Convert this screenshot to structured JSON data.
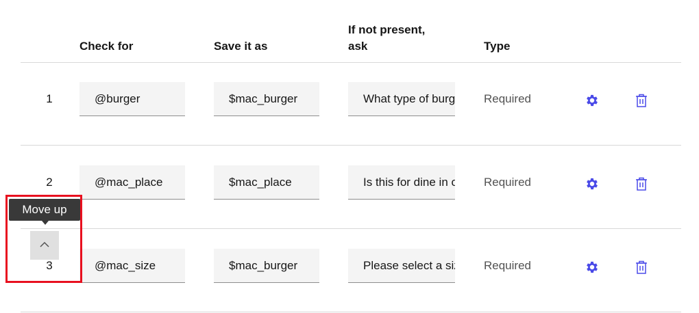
{
  "table": {
    "headers": {
      "check_for": "Check for",
      "save_it_as": "Save it as",
      "if_not_present_line1": "If not present,",
      "if_not_present_line2": "ask",
      "type": "Type"
    },
    "rows": [
      {
        "index": "1",
        "check_for": "@burger",
        "save_as": "$mac_burger",
        "ask": "What type of burger would you like?",
        "type": "Required"
      },
      {
        "index": "2",
        "check_for": "@mac_place",
        "save_as": "$mac_place",
        "ask": "Is this for dine in or take out?",
        "type": "Required"
      },
      {
        "index": "3",
        "check_for": "@mac_size",
        "save_as": "$mac_burger",
        "ask": "Please select a size",
        "type": "Required"
      }
    ]
  },
  "tooltip": {
    "text": "Move up"
  },
  "icons": {
    "settings": "gear-icon",
    "delete": "trash-icon",
    "move_up": "chevron-up-icon"
  },
  "colors": {
    "accent": "#4a4ae8",
    "highlight": "#e8101f",
    "tooltip_bg": "#393939"
  }
}
